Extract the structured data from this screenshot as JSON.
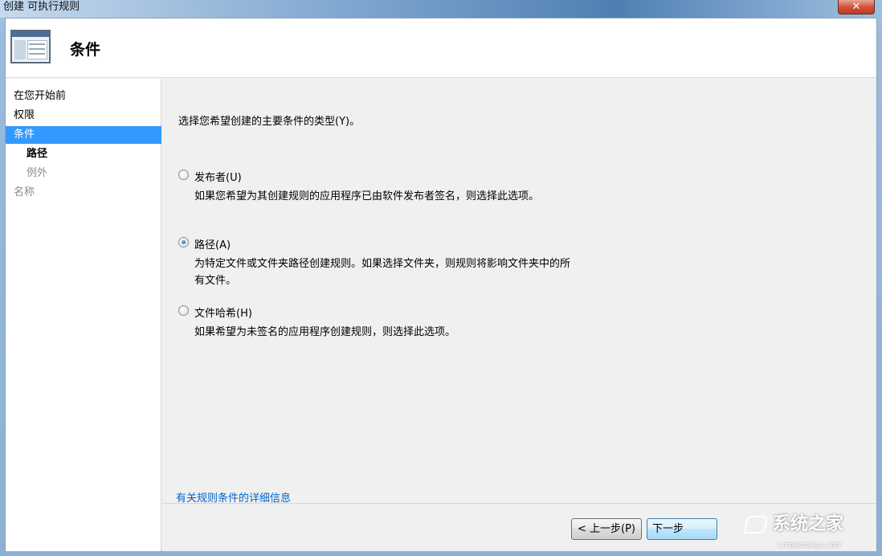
{
  "window": {
    "title": "创建 可执行规则",
    "close_glyph": "✕"
  },
  "header": {
    "title": "条件",
    "icon": "window-form-icon"
  },
  "nav": {
    "items": [
      {
        "label": "在您开始前"
      },
      {
        "label": "权限"
      },
      {
        "label": "条件"
      },
      {
        "label": "路径"
      },
      {
        "label": "例外"
      },
      {
        "label": "名称"
      }
    ]
  },
  "main": {
    "prompt": "选择您希望创建的主要条件的类型(Y)。",
    "options": [
      {
        "label": "发布者(U)",
        "description": "如果您希望为其创建规则的应用程序已由软件发布者签名，则选择此选项。",
        "selected": false
      },
      {
        "label": "路径(A)",
        "description": "为特定文件或文件夹路径创建规则。如果选择文件夹，则规则将影响文件夹中的所有文件。",
        "selected": true
      },
      {
        "label": "文件哈希(H)",
        "description": "如果希望为未签名的应用程序创建规则，则选择此选项。",
        "selected": false
      }
    ],
    "more_info_link": "有关规则条件的详细信息"
  },
  "footer": {
    "prev_label": "< 上一步(P)",
    "next_label": "下一步"
  },
  "watermark": {
    "text": "系统之家",
    "url": "XITONGZHIJIA.NET"
  },
  "colors": {
    "selection": "#3399ff",
    "link": "#0066cc"
  }
}
